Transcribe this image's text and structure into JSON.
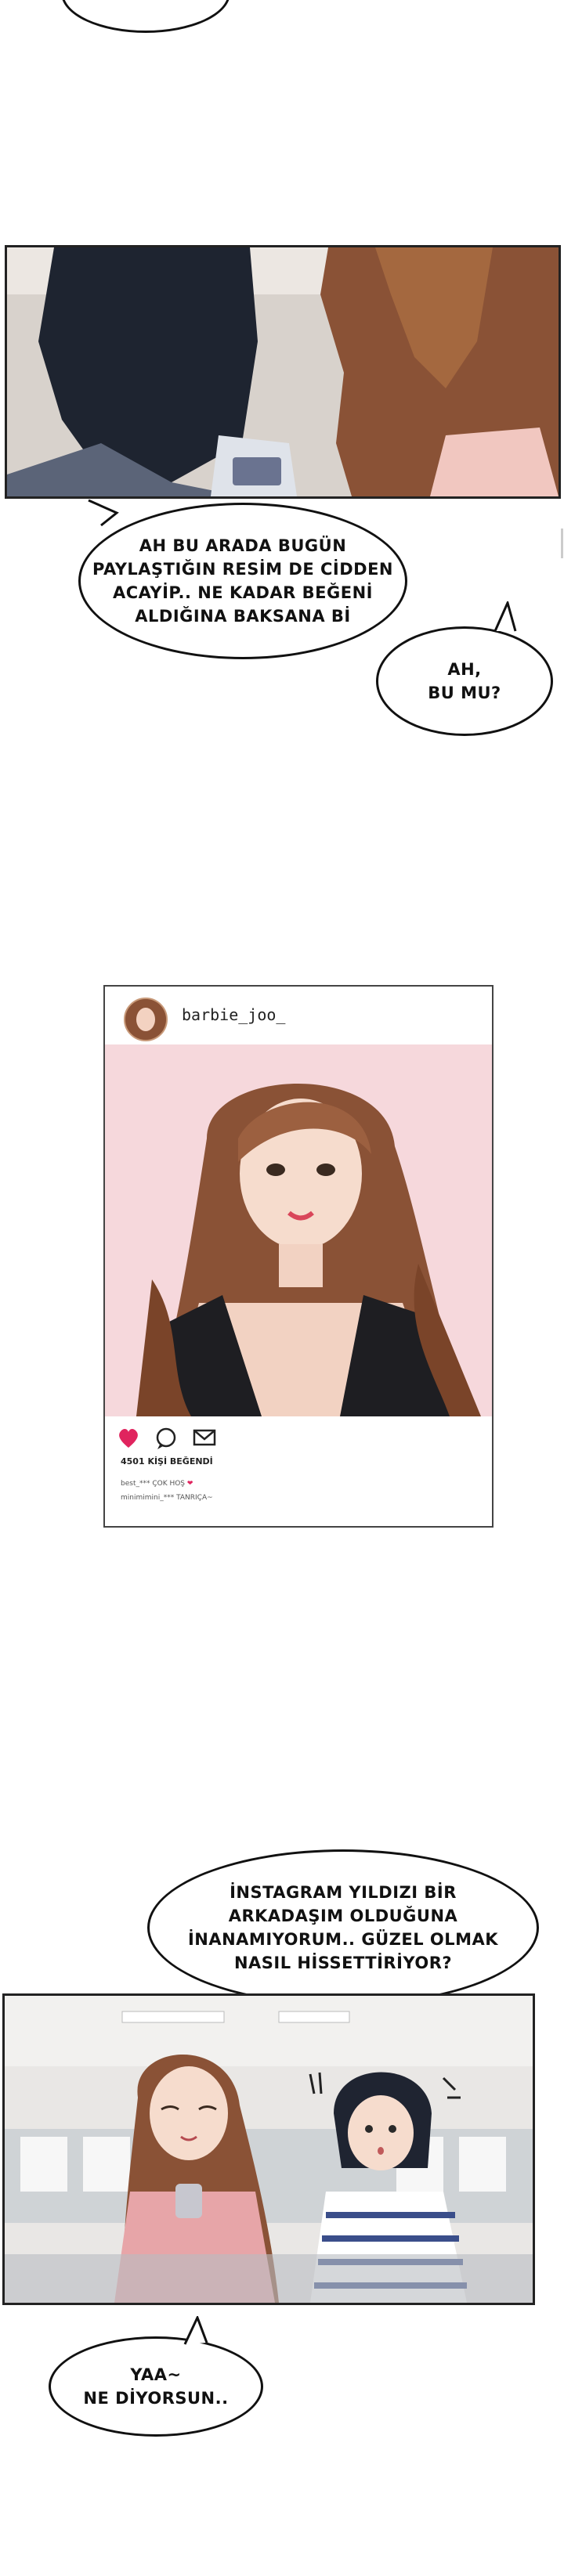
{
  "bubbles": {
    "b1": "AH BU ARADA BUGÜN\nPAYLAŞTIĞIN RESİM DE CİDDEN\nACAYİP.. NE KADAR BEĞENİ\nALDIĞINA BAKSANA Bİ",
    "b2": "AH,\nBU MU?",
    "b3": "İNSTAGRAM YILDIZI BİR\nARKADAŞIM OLDUĞUNA\nİNANAMIYORUM.. GÜZEL OLMAK\nNASIL HİSSETTİRİYOR?",
    "b4": "YAA~\nNE DİYORSUN.."
  },
  "post": {
    "username": "barbie_joo_",
    "likes": "4501 KİŞİ BEĞENDİ",
    "comment1": "best_*** ÇOK HOŞ",
    "comment2": "minimimini_*** TANRIÇA~"
  },
  "colors": {
    "heart": "#e0245e",
    "photo_bg": "#f6d8dc",
    "hair": "#8a5236"
  },
  "icons": [
    "heart-icon",
    "comment-icon",
    "share-icon"
  ]
}
